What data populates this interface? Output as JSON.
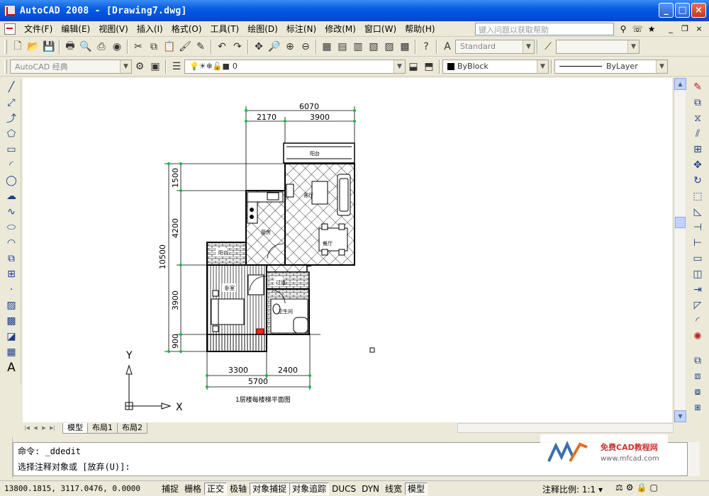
{
  "window": {
    "title": "AutoCAD 2008 - [Drawing7.dwg]",
    "min": "_",
    "max": "□",
    "close": "×"
  },
  "menu": [
    "文件(F)",
    "编辑(E)",
    "视图(V)",
    "插入(I)",
    "格式(O)",
    "工具(T)",
    "绘图(D)",
    "标注(N)",
    "修改(M)",
    "窗口(W)",
    "帮助(H)"
  ],
  "help_search": {
    "placeholder": "键入问题以获取帮助"
  },
  "toolbar": {
    "text_style": "Standard",
    "workspace": "AutoCAD 经典",
    "layer": "0",
    "color": "ByBlock",
    "linetype": "ByLayer"
  },
  "drawing": {
    "dims_top": {
      "total": "6070",
      "left": "2170",
      "right": "3900"
    },
    "dims_left": {
      "total": "10500",
      "d1": "1500",
      "d2": "4200",
      "d3": "3900",
      "d4": "900"
    },
    "dims_bottom": {
      "left": "3300",
      "right": "2400",
      "total": "5700"
    },
    "rooms": {
      "balcony": "阳台",
      "living": "客厅",
      "kitchen": "厨房",
      "dining": "餐厅",
      "bedroom": "卧室",
      "bath": "卫生间",
      "storage": "阳台",
      "hall": "过道"
    },
    "caption": "1层楼每楼梯平面图",
    "ucs_x": "X",
    "ucs_y": "Y"
  },
  "tabs": [
    "模型",
    "布局1",
    "布局2"
  ],
  "command": {
    "line1": "命令: _ddedit",
    "line2": "选择注释对象或 [放弃(U)]:"
  },
  "watermark": {
    "text": "免费CAD教程网",
    "url": "www.mfcad.com"
  },
  "status": {
    "coords": "13800.1815, 3117.0476, 0.0000",
    "toggles": [
      {
        "label": "捕捉",
        "on": false
      },
      {
        "label": "栅格",
        "on": false
      },
      {
        "label": "正交",
        "on": true
      },
      {
        "label": "极轴",
        "on": false
      },
      {
        "label": "对象捕捉",
        "on": true
      },
      {
        "label": "对象追踪",
        "on": true
      },
      {
        "label": "DUCS",
        "on": false
      },
      {
        "label": "DYN",
        "on": false
      },
      {
        "label": "线宽",
        "on": false
      },
      {
        "label": "模型",
        "on": true
      }
    ],
    "scale_label": "注释比例:",
    "scale_value": "1:1"
  }
}
